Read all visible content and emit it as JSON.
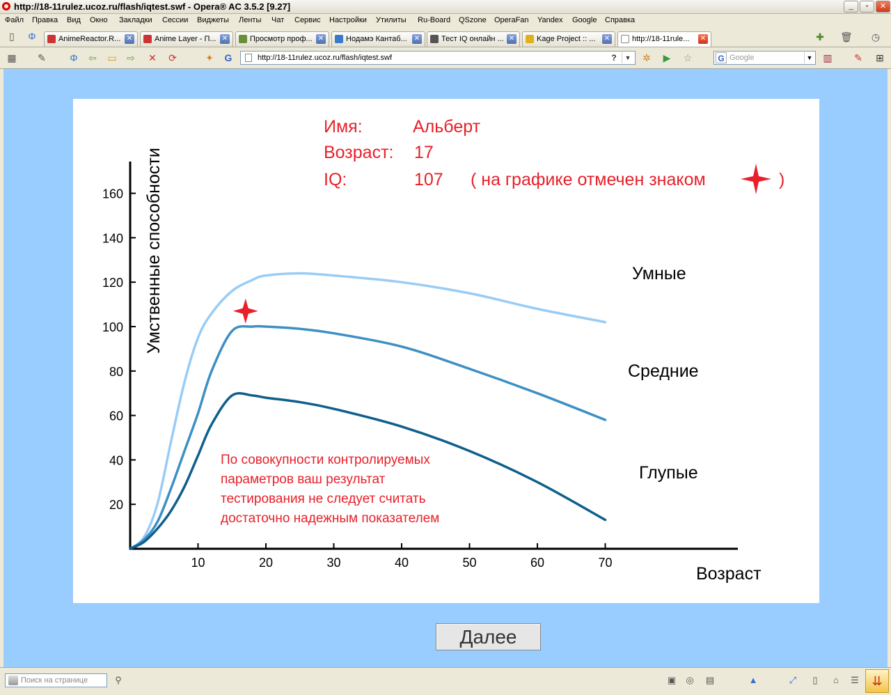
{
  "window": {
    "title": "http://18-11rulez.ucoz.ru/flash/iqtest.swf - Opera® AC 3.5.2 [9.27]"
  },
  "menu": [
    "Файл",
    "Правка",
    "Вид",
    "Окно",
    "Закладки",
    "Сессии",
    "Виджеты",
    "Ленты",
    "Чат",
    "Сервис",
    "Настройки",
    "Утилиты",
    "Ru-Board",
    "QSzone",
    "OperaFan",
    "Yandex",
    "Google",
    "Справка"
  ],
  "tabs": [
    {
      "label": "AnimeReactor.R..."
    },
    {
      "label": "Anime Layer - П..."
    },
    {
      "label": "Просмотр проф..."
    },
    {
      "label": "Нодамэ Кантаб..."
    },
    {
      "label": "Тест IQ онлайн ..."
    },
    {
      "label": "Kage Project :: ..."
    },
    {
      "label": "http://18-11rule..."
    }
  ],
  "address": {
    "url": "http://18-11rulez.ucoz.ru/flash/iqtest.swf"
  },
  "search": {
    "placeholder": "Google"
  },
  "status": {
    "find_placeholder": "Поиск на странице"
  },
  "result": {
    "name_label": "Имя:",
    "name_value": "Альберт",
    "age_label": "Возраст:",
    "age_value": "17",
    "iq_label": "IQ:",
    "iq_value": "107",
    "marker_note_open": "( на графике отмечен знаком",
    "marker_note_close": ")",
    "disclaimer": [
      "По совокупности контролируемых",
      "параметров ваш результат",
      "тестирования не следует считать",
      "достаточно надежным показателем"
    ]
  },
  "next_button": "Далее",
  "chart_data": {
    "type": "line",
    "xlabel": "Возраст",
    "ylabel": "Умственные способности",
    "xlim": [
      0,
      80
    ],
    "ylim": [
      0,
      175
    ],
    "xticks": [
      10,
      20,
      30,
      40,
      50,
      60,
      70
    ],
    "yticks": [
      20,
      40,
      60,
      80,
      100,
      120,
      140,
      160
    ],
    "series": [
      {
        "name": "Умные",
        "color": "#99ccf5",
        "x": [
          0,
          2,
          4,
          6,
          8,
          10,
          12,
          15,
          18,
          20,
          25,
          30,
          40,
          50,
          60,
          70
        ],
        "y": [
          0,
          5,
          20,
          48,
          75,
          95,
          106,
          116,
          121,
          123,
          124,
          123,
          120,
          115,
          108,
          102
        ]
      },
      {
        "name": "Средние",
        "color": "#3d8fc4",
        "x": [
          0,
          2,
          4,
          6,
          8,
          10,
          12,
          15,
          18,
          20,
          25,
          30,
          40,
          50,
          60,
          70
        ],
        "y": [
          0,
          4,
          12,
          27,
          44,
          61,
          80,
          98,
          100,
          100,
          99,
          97,
          91,
          81,
          70,
          58
        ]
      },
      {
        "name": "Глупые",
        "color": "#0f5f8c",
        "x": [
          0,
          2,
          4,
          6,
          8,
          10,
          12,
          15,
          18,
          20,
          25,
          30,
          40,
          50,
          60,
          70
        ],
        "y": [
          0,
          3,
          9,
          17,
          28,
          42,
          56,
          69,
          69,
          68,
          66,
          63,
          55,
          44,
          30,
          13
        ]
      }
    ],
    "marker": {
      "x": 17,
      "y": 107,
      "color": "#e8202a"
    }
  }
}
